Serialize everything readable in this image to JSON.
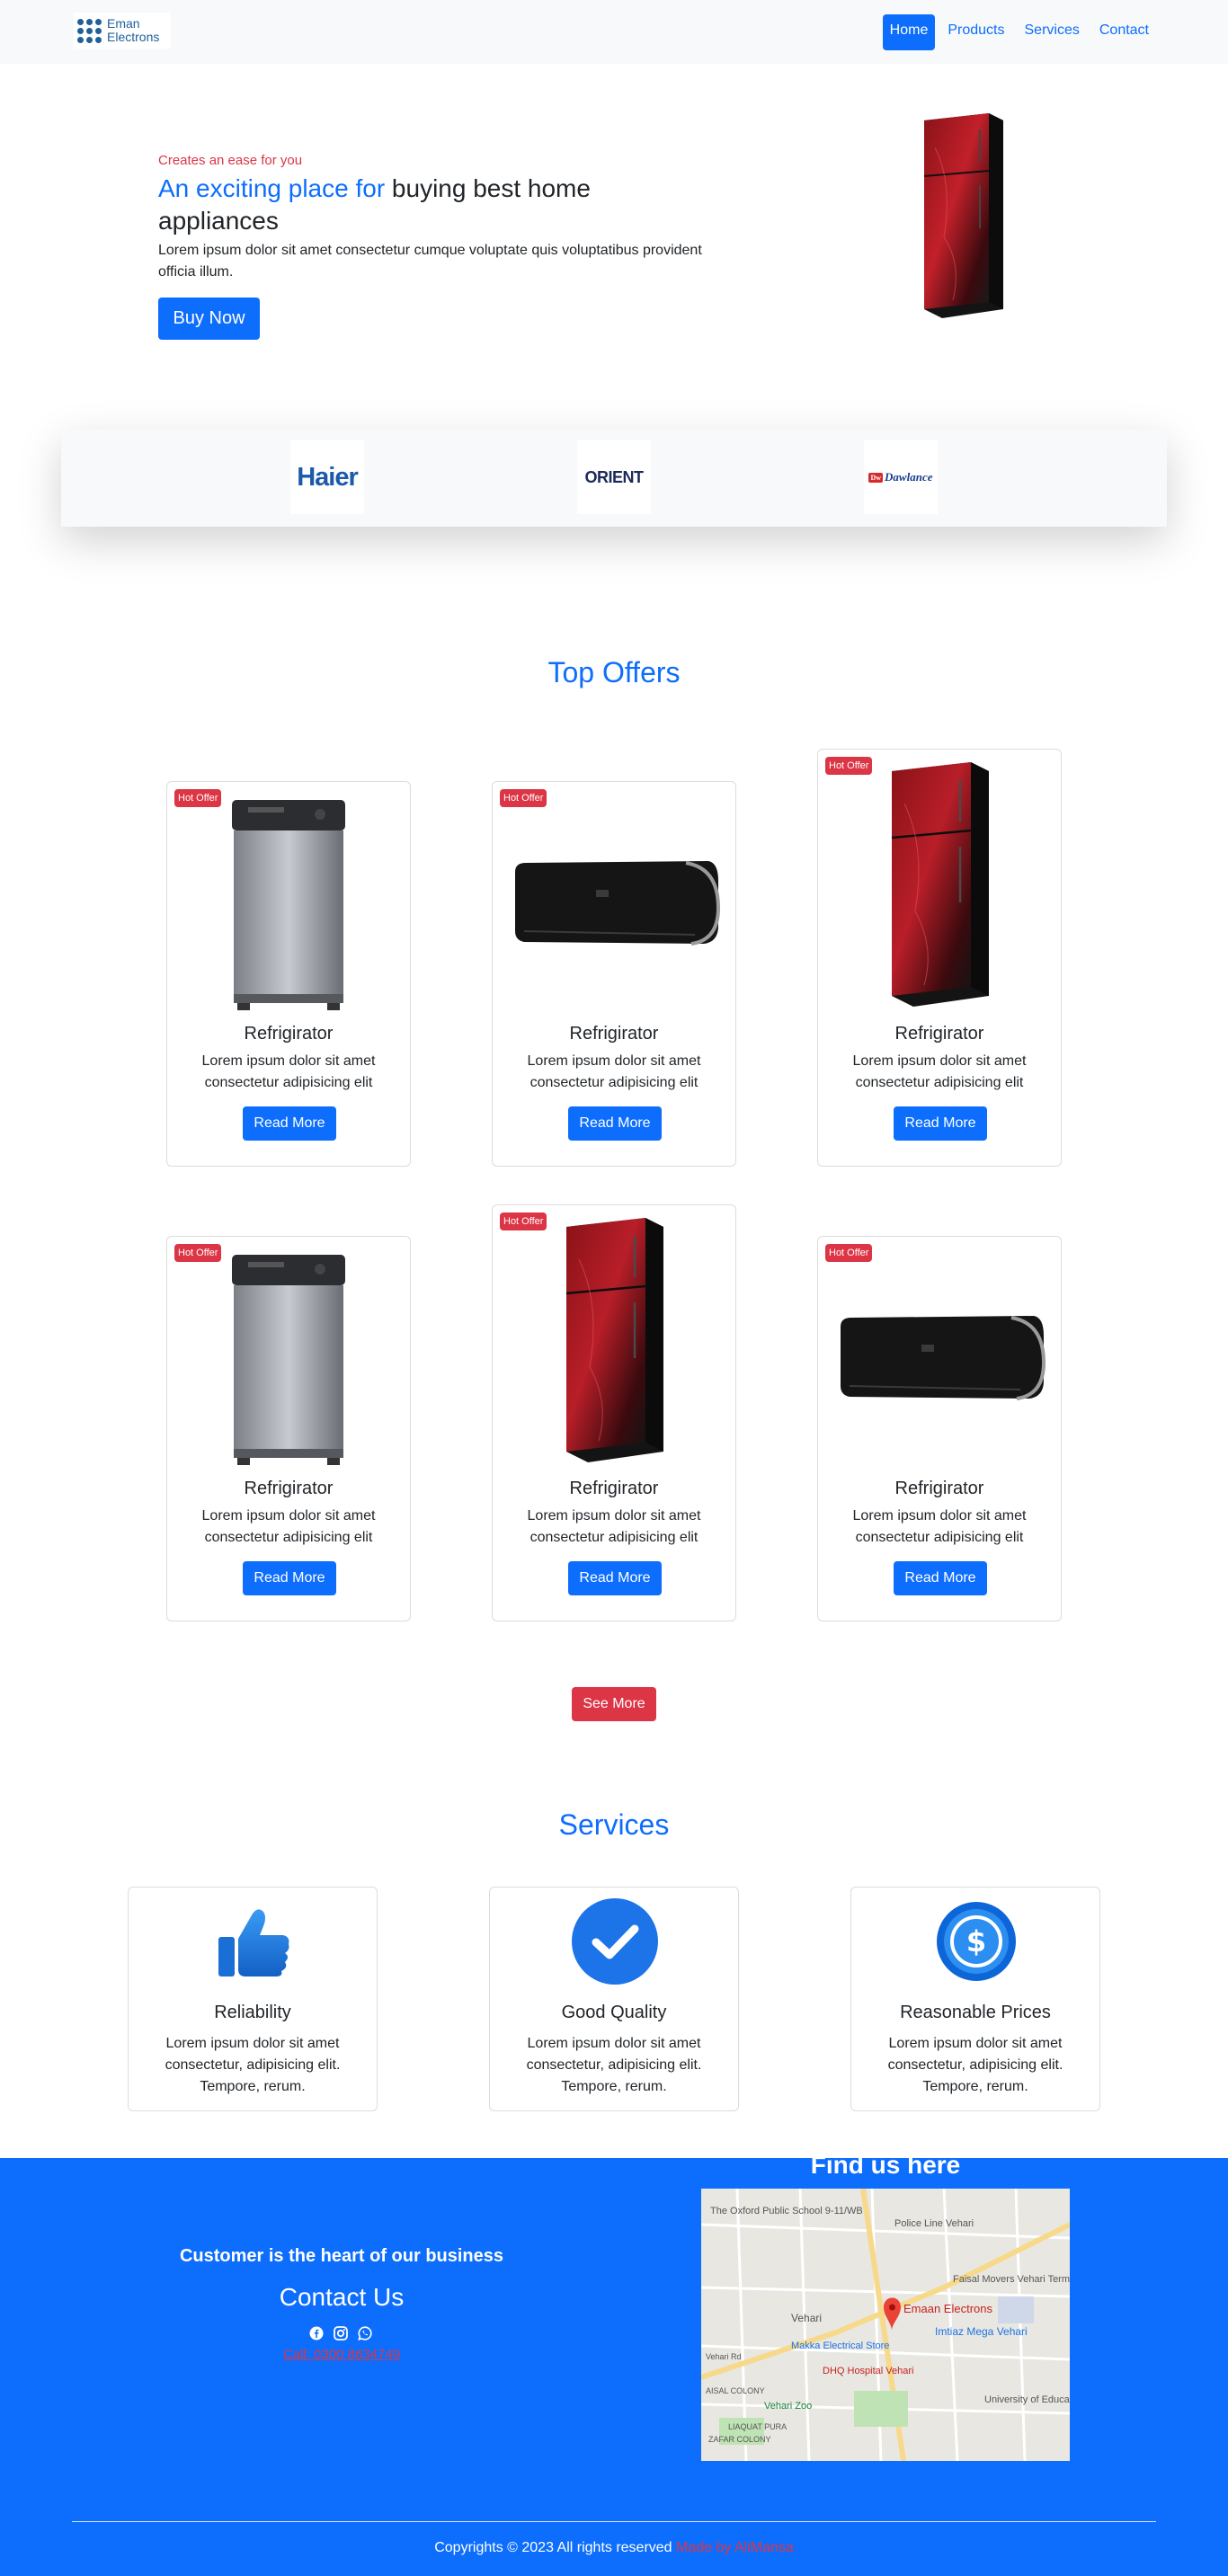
{
  "navbar": {
    "logo_text_1": "Eman",
    "logo_text_2": "Electrons",
    "links": [
      "Home",
      "Products",
      "Services",
      "Contact"
    ]
  },
  "hero": {
    "tag": "Creates an ease for you",
    "title_accent": "An exciting place for",
    "title_rest": "buying best home appliances",
    "description": "Lorem ipsum dolor sit amet consectetur cumque voluptate quis voluptatibus provident officia illum.",
    "button": "Buy Now"
  },
  "brands": {
    "haier": "Haier",
    "orient": "ORIENT",
    "dawlance_badge": "Dw",
    "dawlance": "Dawlance"
  },
  "offers": {
    "title": "Top Offers",
    "badge": "Hot Offer",
    "cards": [
      {
        "title": "Refrigirator",
        "text": "Lorem ipsum dolor sit amet consectetur adipisicing elit",
        "button": "Read More",
        "image": "washing-machine"
      },
      {
        "title": "Refrigirator",
        "text": "Lorem ipsum dolor sit amet consectetur adipisicing elit",
        "button": "Read More",
        "image": "air-conditioner"
      },
      {
        "title": "Refrigirator",
        "text": "Lorem ipsum dolor sit amet consectetur adipisicing elit",
        "button": "Read More",
        "image": "refrigerator"
      },
      {
        "title": "Refrigirator",
        "text": "Lorem ipsum dolor sit amet consectetur adipisicing elit",
        "button": "Read More",
        "image": "washing-machine"
      },
      {
        "title": "Refrigirator",
        "text": "Lorem ipsum dolor sit amet consectetur adipisicing elit",
        "button": "Read More",
        "image": "refrigerator"
      },
      {
        "title": "Refrigirator",
        "text": "Lorem ipsum dolor sit amet consectetur adipisicing elit",
        "button": "Read More",
        "image": "air-conditioner"
      }
    ],
    "see_more": "See More"
  },
  "services": {
    "title": "Services",
    "items": [
      {
        "title": "Reliability",
        "text": "Lorem ipsum dolor sit amet consectetur, adipisicing elit. Tempore, rerum.",
        "icon": "thumbs-up-icon"
      },
      {
        "title": "Good Quality",
        "text": "Lorem ipsum dolor sit amet consectetur, adipisicing elit. Tempore, rerum.",
        "icon": "check-circle-icon"
      },
      {
        "title": "Reasonable Prices",
        "text": "Lorem ipsum dolor sit amet consectetur, adipisicing elit. Tempore, rerum.",
        "icon": "dollar-coin-icon"
      }
    ]
  },
  "footer": {
    "tagline": "Customer is the heart of our business",
    "contact_title": "Contact Us",
    "call": "Call: 0300 8634749",
    "find_title": "Find us here",
    "copyright": "Copyrights © 2023 All rights reserved",
    "made_by": "Made by AliMansa"
  },
  "map": {
    "labels": [
      "The Oxford Public School 9-11/WB",
      "Police Line Vehari",
      "Faisal Movers Vehari Terminal",
      "Emaan Electrons",
      "Imtiaz Mega Vehari",
      "Makka Electrical Store",
      "DHQ Hospital Vehari",
      "Vehari Zoo",
      "University of Education, Vehari Campus",
      "LIAQUAT PURA",
      "ZAFAR COLONY",
      "AISAL COLONY",
      "Vehari",
      "Vehari Rd"
    ]
  },
  "colors": {
    "primary": "#0d6efd",
    "danger": "#dc3545",
    "light": "#f8f9fa"
  }
}
